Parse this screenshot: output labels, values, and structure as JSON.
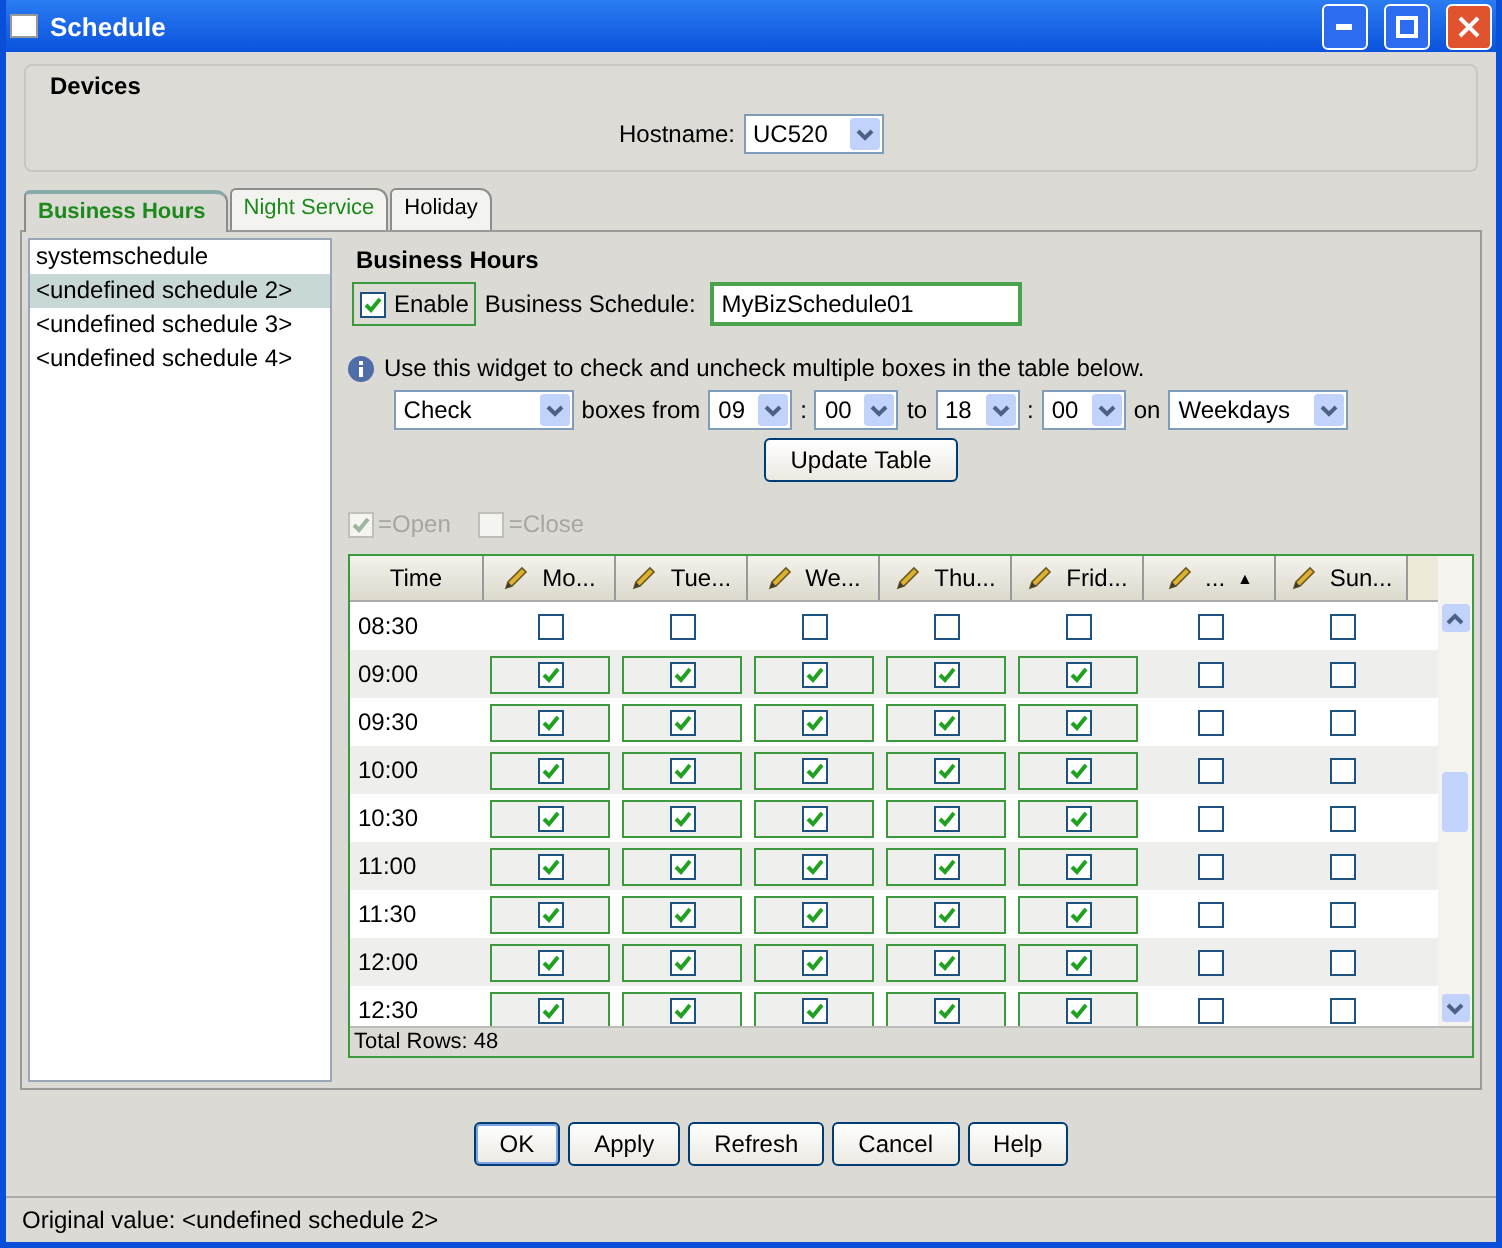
{
  "window": {
    "title": "Schedule"
  },
  "devices": {
    "title": "Devices",
    "hostname_label": "Hostname:",
    "hostname": "UC520"
  },
  "tabs": [
    {
      "label": "Business Hours",
      "selected": true
    },
    {
      "label": "Night Service",
      "selected": false
    },
    {
      "label": "Holiday",
      "selected": false
    }
  ],
  "schedules": [
    {
      "label": "systemschedule",
      "selected": false
    },
    {
      "label": "<undefined schedule 2>",
      "selected": true
    },
    {
      "label": "<undefined schedule 3>",
      "selected": false
    },
    {
      "label": "<undefined schedule 4>",
      "selected": false
    }
  ],
  "business_hours": {
    "title": "Business Hours",
    "enable_label": "Enable",
    "enabled": true,
    "schedule_label": "Business Schedule:",
    "schedule_name": "MyBizSchedule01",
    "info": "Use this widget to check and uncheck multiple boxes in the table below.",
    "widget": [
      {
        "kind": "select",
        "text": "Check"
      },
      {
        "kind": "label",
        "text": "boxes from"
      },
      {
        "kind": "select",
        "text": "09"
      },
      {
        "kind": "label",
        "text": ":"
      },
      {
        "kind": "select",
        "text": "00"
      },
      {
        "kind": "label",
        "text": "to"
      },
      {
        "kind": "select",
        "text": "18"
      },
      {
        "kind": "label",
        "text": ":"
      },
      {
        "kind": "select",
        "text": "00"
      },
      {
        "kind": "label",
        "text": "on"
      },
      {
        "kind": "select",
        "text": "Weekdays"
      }
    ],
    "update_button": "Update Table",
    "legend": [
      {
        "label": "=Open",
        "checked": true
      },
      {
        "label": "=Close",
        "checked": false
      }
    ]
  },
  "table": {
    "columns": [
      {
        "label": "Time",
        "editable": false
      },
      {
        "label": "Mo...",
        "editable": true
      },
      {
        "label": "Tue...",
        "editable": true
      },
      {
        "label": "We...",
        "editable": true
      },
      {
        "label": "Thu...",
        "editable": true
      },
      {
        "label": "Frid...",
        "editable": true
      },
      {
        "label": "...",
        "editable": true,
        "sort_indicator": "▲"
      },
      {
        "label": "Sun...",
        "editable": true
      }
    ],
    "rows": [
      {
        "time": "08:30",
        "cells": [
          false,
          false,
          false,
          false,
          false,
          false,
          false
        ]
      },
      {
        "time": "09:00",
        "cells": [
          true,
          true,
          true,
          true,
          true,
          false,
          false
        ]
      },
      {
        "time": "09:30",
        "cells": [
          true,
          true,
          true,
          true,
          true,
          false,
          false
        ]
      },
      {
        "time": "10:00",
        "cells": [
          true,
          true,
          true,
          true,
          true,
          false,
          false
        ]
      },
      {
        "time": "10:30",
        "cells": [
          true,
          true,
          true,
          true,
          true,
          false,
          false
        ]
      },
      {
        "time": "11:00",
        "cells": [
          true,
          true,
          true,
          true,
          true,
          false,
          false
        ]
      },
      {
        "time": "11:30",
        "cells": [
          true,
          true,
          true,
          true,
          true,
          false,
          false
        ]
      },
      {
        "time": "12:00",
        "cells": [
          true,
          true,
          true,
          true,
          true,
          false,
          false
        ]
      },
      {
        "time": "12:30",
        "cells": [
          true,
          true,
          true,
          true,
          true,
          false,
          false
        ]
      }
    ],
    "total_rows": "Total Rows: 48"
  },
  "buttons": [
    {
      "label": "OK",
      "focused": true
    },
    {
      "label": "Apply",
      "focused": false
    },
    {
      "label": "Refresh",
      "focused": false
    },
    {
      "label": "Cancel",
      "focused": false
    },
    {
      "label": "Help",
      "focused": false
    }
  ],
  "status_bar": "Original value: <undefined schedule 2>"
}
